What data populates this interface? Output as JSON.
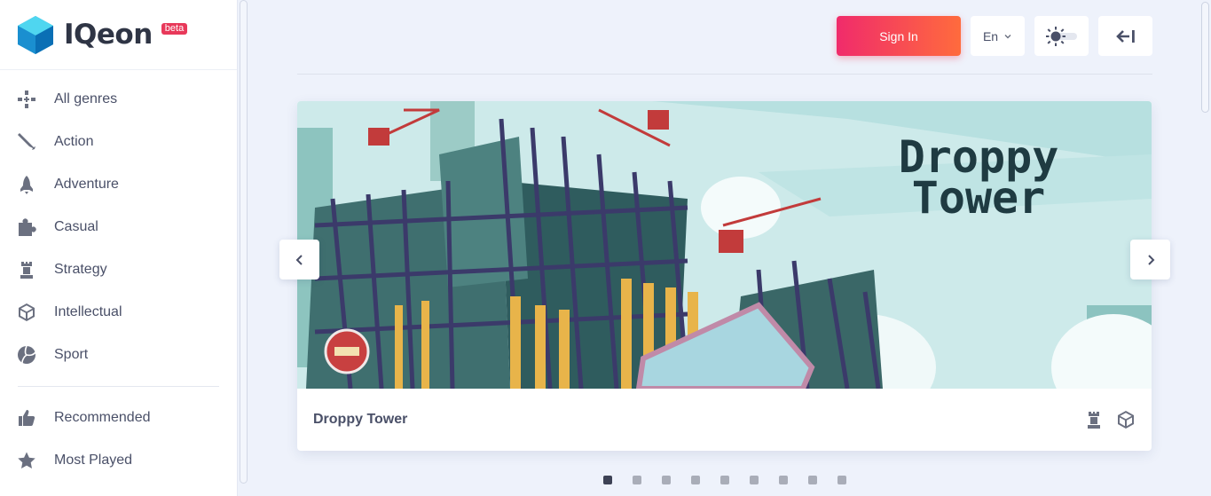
{
  "brand": {
    "name": "IQeon",
    "badge": "beta"
  },
  "sidebar": {
    "genres": [
      {
        "label": "All genres",
        "icon": "gamepad-icon"
      },
      {
        "label": "Action",
        "icon": "sword-icon"
      },
      {
        "label": "Adventure",
        "icon": "rocket-icon"
      },
      {
        "label": "Casual",
        "icon": "puzzle-icon"
      },
      {
        "label": "Strategy",
        "icon": "chess-rook-icon"
      },
      {
        "label": "Intellectual",
        "icon": "cube-icon"
      },
      {
        "label": "Sport",
        "icon": "volleyball-icon"
      }
    ],
    "lists": [
      {
        "label": "Recommended",
        "icon": "thumbs-up-icon"
      },
      {
        "label": "Most Played",
        "icon": "star-icon"
      }
    ]
  },
  "header": {
    "sign_in_label": "Sign In",
    "language": "En",
    "sign_in_color_start": "#f02b6b",
    "sign_in_color_end": "#ff6b3d"
  },
  "carousel": {
    "slide": {
      "banner_title_line1": "Droppy",
      "banner_title_line2": "Tower",
      "game_name": "Droppy Tower",
      "genre_icons": [
        "chess-rook-icon",
        "cube-icon"
      ]
    },
    "slide_count": 9,
    "active_index": 0
  }
}
